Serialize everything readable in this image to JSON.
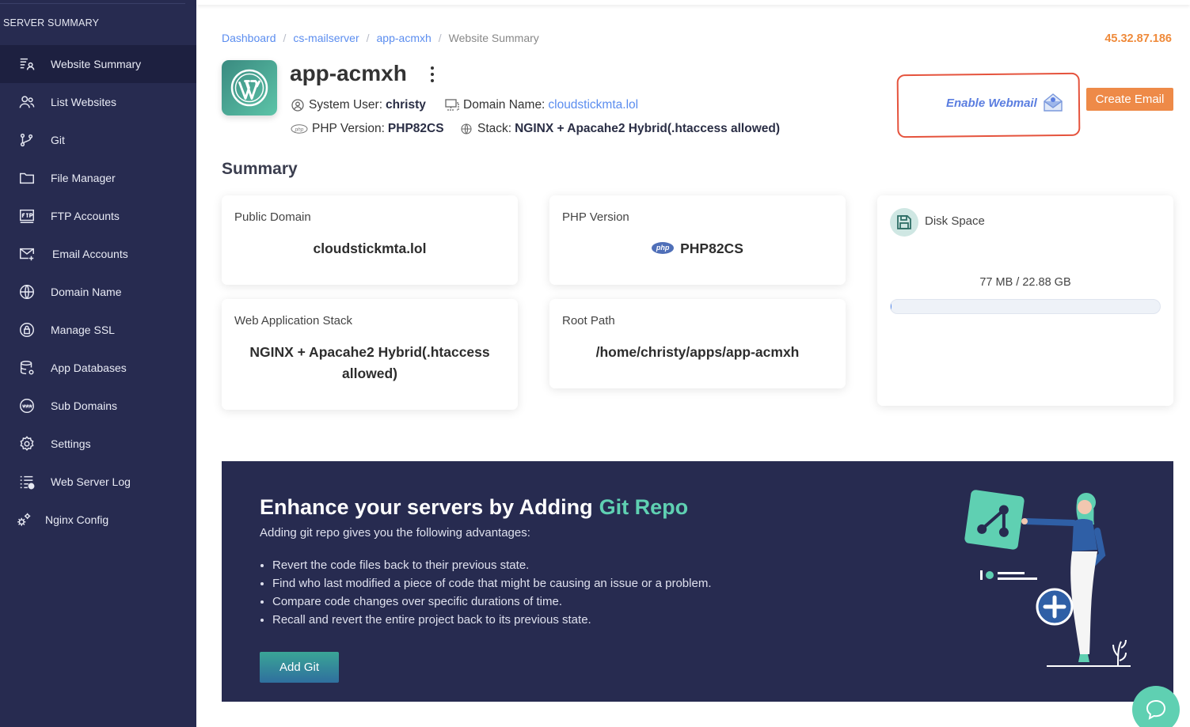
{
  "sidebar": {
    "section_title": "SERVER SUMMARY",
    "items": [
      {
        "label": "Website Summary",
        "icon": "list-person-icon",
        "active": true
      },
      {
        "label": "List Websites",
        "icon": "users-icon"
      },
      {
        "label": "Git",
        "icon": "git-branch-icon"
      },
      {
        "label": "File Manager",
        "icon": "folder-icon"
      },
      {
        "label": "FTP Accounts",
        "icon": "ftp-icon"
      },
      {
        "label": "Email Accounts",
        "icon": "mail-plus-icon"
      },
      {
        "label": "Domain Name",
        "icon": "globe-icon"
      },
      {
        "label": "Manage SSL",
        "icon": "ssl-lock-icon"
      },
      {
        "label": "App Databases",
        "icon": "database-icon"
      },
      {
        "label": "Sub Domains",
        "icon": "www-icon"
      },
      {
        "label": "Settings",
        "icon": "gear-icon"
      },
      {
        "label": "Web Server Log",
        "icon": "log-list-icon"
      },
      {
        "label": "Nginx Config",
        "icon": "gears-icon"
      }
    ]
  },
  "breadcrumb": {
    "items": [
      "Dashboard",
      "cs-mailserver",
      "app-acmxh"
    ],
    "current": "Website Summary"
  },
  "server_ip": "45.32.87.186",
  "app": {
    "name": "app-acmxh",
    "system_user_label": "System User:",
    "system_user": "christy",
    "domain_label": "Domain Name:",
    "domain": "cloudstickmta.lol",
    "php_label": "PHP Version:",
    "php_version": "PHP82CS",
    "stack_label": "Stack:",
    "stack": "NGINX + Apacahe2 Hybrid(.htaccess allowed)"
  },
  "actions": {
    "enable_webmail": "Enable Webmail",
    "create_email": "Create Email"
  },
  "summary": {
    "title": "Summary",
    "public_domain_label": "Public Domain",
    "public_domain": "cloudstickmta.lol",
    "php_version_label": "PHP Version",
    "php_badge": "php",
    "php_version": "PHP82CS",
    "stack_label": "Web Application Stack",
    "stack": "NGINX + Apacahe2 Hybrid(.htaccess allowed)",
    "root_path_label": "Root Path",
    "root_path": "/home/christy/apps/app-acmxh",
    "disk_label": "Disk Space",
    "disk_usage": "77 MB / 22.88 GB",
    "disk_used_fraction": 0.0033
  },
  "banner": {
    "title": "Enhance your servers by Adding",
    "title_accent": "Git Repo",
    "subtitle": "Adding git repo gives you the following advantages:",
    "points": [
      "Revert the code files back to their previous state.",
      "Find who last modified a piece of code that might be causing an issue or a problem.",
      "Compare code changes over specific durations of time.",
      "Recall and revert the entire project back to its previous state."
    ],
    "button": "Add Git"
  },
  "colors": {
    "sidebar_bg": "#272b50",
    "accent_blue": "#5b8def",
    "accent_orange": "#ee8a48",
    "accent_green": "#5fd0b2"
  }
}
